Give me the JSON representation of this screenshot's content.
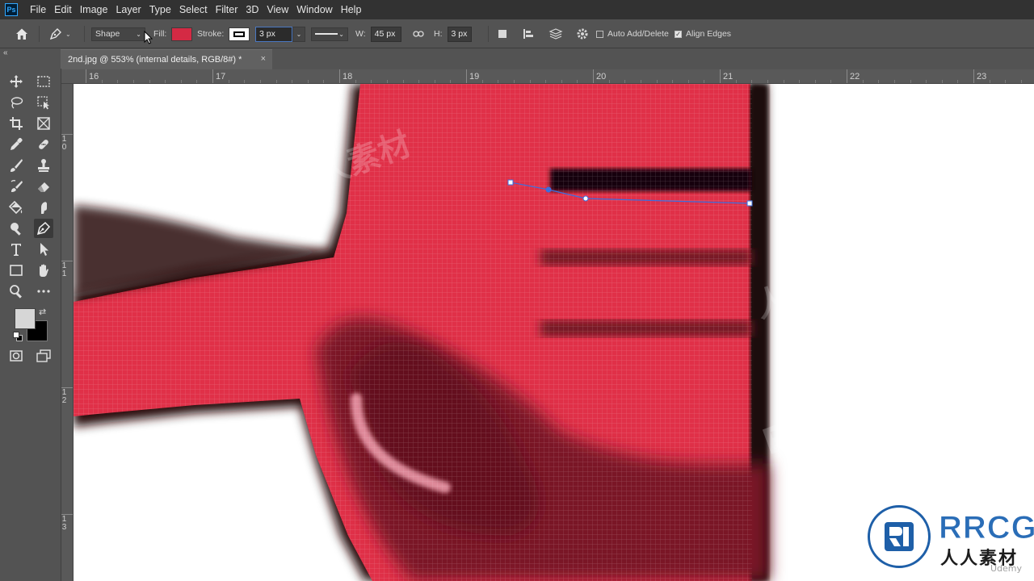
{
  "app": {
    "logo_text": "Ps"
  },
  "menu": [
    "File",
    "Edit",
    "Image",
    "Layer",
    "Type",
    "Select",
    "Filter",
    "3D",
    "View",
    "Window",
    "Help"
  ],
  "options_bar": {
    "mode": "Shape",
    "fill_label": "Fill:",
    "fill_color": "#d42a44",
    "stroke_label": "Stroke:",
    "stroke_width": "3 px",
    "width_label": "W:",
    "width_value": "45 px",
    "height_label": "H:",
    "height_value": "3 px",
    "auto_add_delete": {
      "label": "Auto Add/Delete",
      "checked": false
    },
    "align_edges": {
      "label": "Align Edges",
      "checked": true
    }
  },
  "document_tab": {
    "title": "2nd.jpg @ 553% (internal details, RGB/8#) *",
    "close": "×"
  },
  "ruler": {
    "horizontal": [
      "16",
      "17",
      "18",
      "19",
      "20",
      "21",
      "22",
      "23"
    ],
    "vertical": [
      "1\n0",
      "1\n1",
      "1\n2",
      "1\n3"
    ]
  },
  "tools": [
    "move-tool",
    "marquee-tool",
    "lasso-tool",
    "object-selection-tool",
    "crop-tool",
    "frame-tool",
    "eyedropper-tool",
    "healing-brush-tool",
    "brush-tool",
    "clone-stamp-tool",
    "history-brush-tool",
    "eraser-tool",
    "paint-bucket-tool",
    "smudge-tool",
    "dodge-tool",
    "pen-tool",
    "type-tool",
    "path-selection-tool",
    "rectangle-tool",
    "hand-tool",
    "zoom-tool",
    "more-tools"
  ],
  "colors": {
    "foreground": "#d6d6d6",
    "background": "#000000",
    "artwork_red": "#e03048",
    "artwork_dark": "#7a1828"
  },
  "watermark": {
    "brand": "RRCG",
    "chinese": "人人素材",
    "udemy": "Udemy"
  }
}
